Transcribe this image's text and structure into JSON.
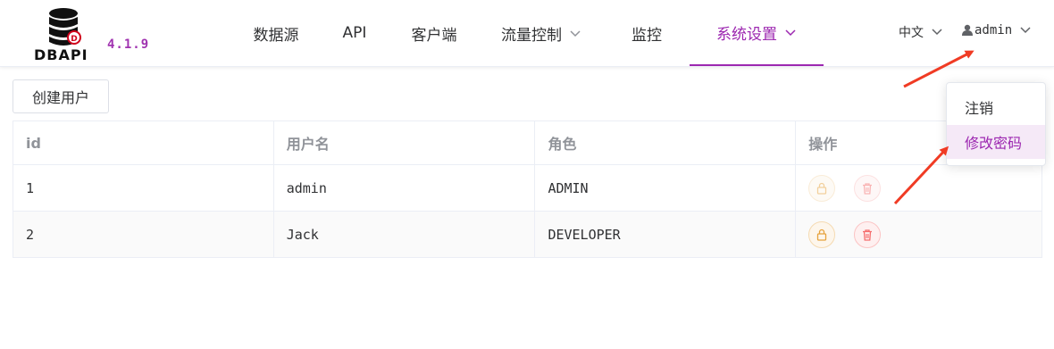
{
  "app": {
    "logo_text": "DBAPI",
    "version": "4.1.9"
  },
  "nav": {
    "items": [
      {
        "label": "数据源",
        "has_dropdown": false,
        "active": false
      },
      {
        "label": "API",
        "has_dropdown": false,
        "active": false
      },
      {
        "label": "客户端",
        "has_dropdown": false,
        "active": false
      },
      {
        "label": "流量控制",
        "has_dropdown": true,
        "active": false
      },
      {
        "label": "监控",
        "has_dropdown": false,
        "active": false
      },
      {
        "label": "系统设置",
        "has_dropdown": true,
        "active": true
      }
    ]
  },
  "header": {
    "language": "中文",
    "user": "admin"
  },
  "toolbar": {
    "create_user_label": "创建用户"
  },
  "table": {
    "columns": [
      "id",
      "用户名",
      "角色",
      "操作"
    ],
    "rows": [
      {
        "id": "1",
        "username": "admin",
        "role": "ADMIN"
      },
      {
        "id": "2",
        "username": "Jack",
        "role": "DEVELOPER"
      }
    ]
  },
  "user_menu": {
    "items": [
      {
        "label": "注销",
        "hovered": false
      },
      {
        "label": "修改密码",
        "hovered": true
      }
    ]
  },
  "colors": {
    "accent": "#9c27b0",
    "arrow": "#f03b24",
    "lock": "#e6a23c",
    "delete": "#f56c6c"
  },
  "icons": [
    "database-icon",
    "chevron-down-icon",
    "user-icon",
    "lock-icon",
    "delete-icon"
  ]
}
